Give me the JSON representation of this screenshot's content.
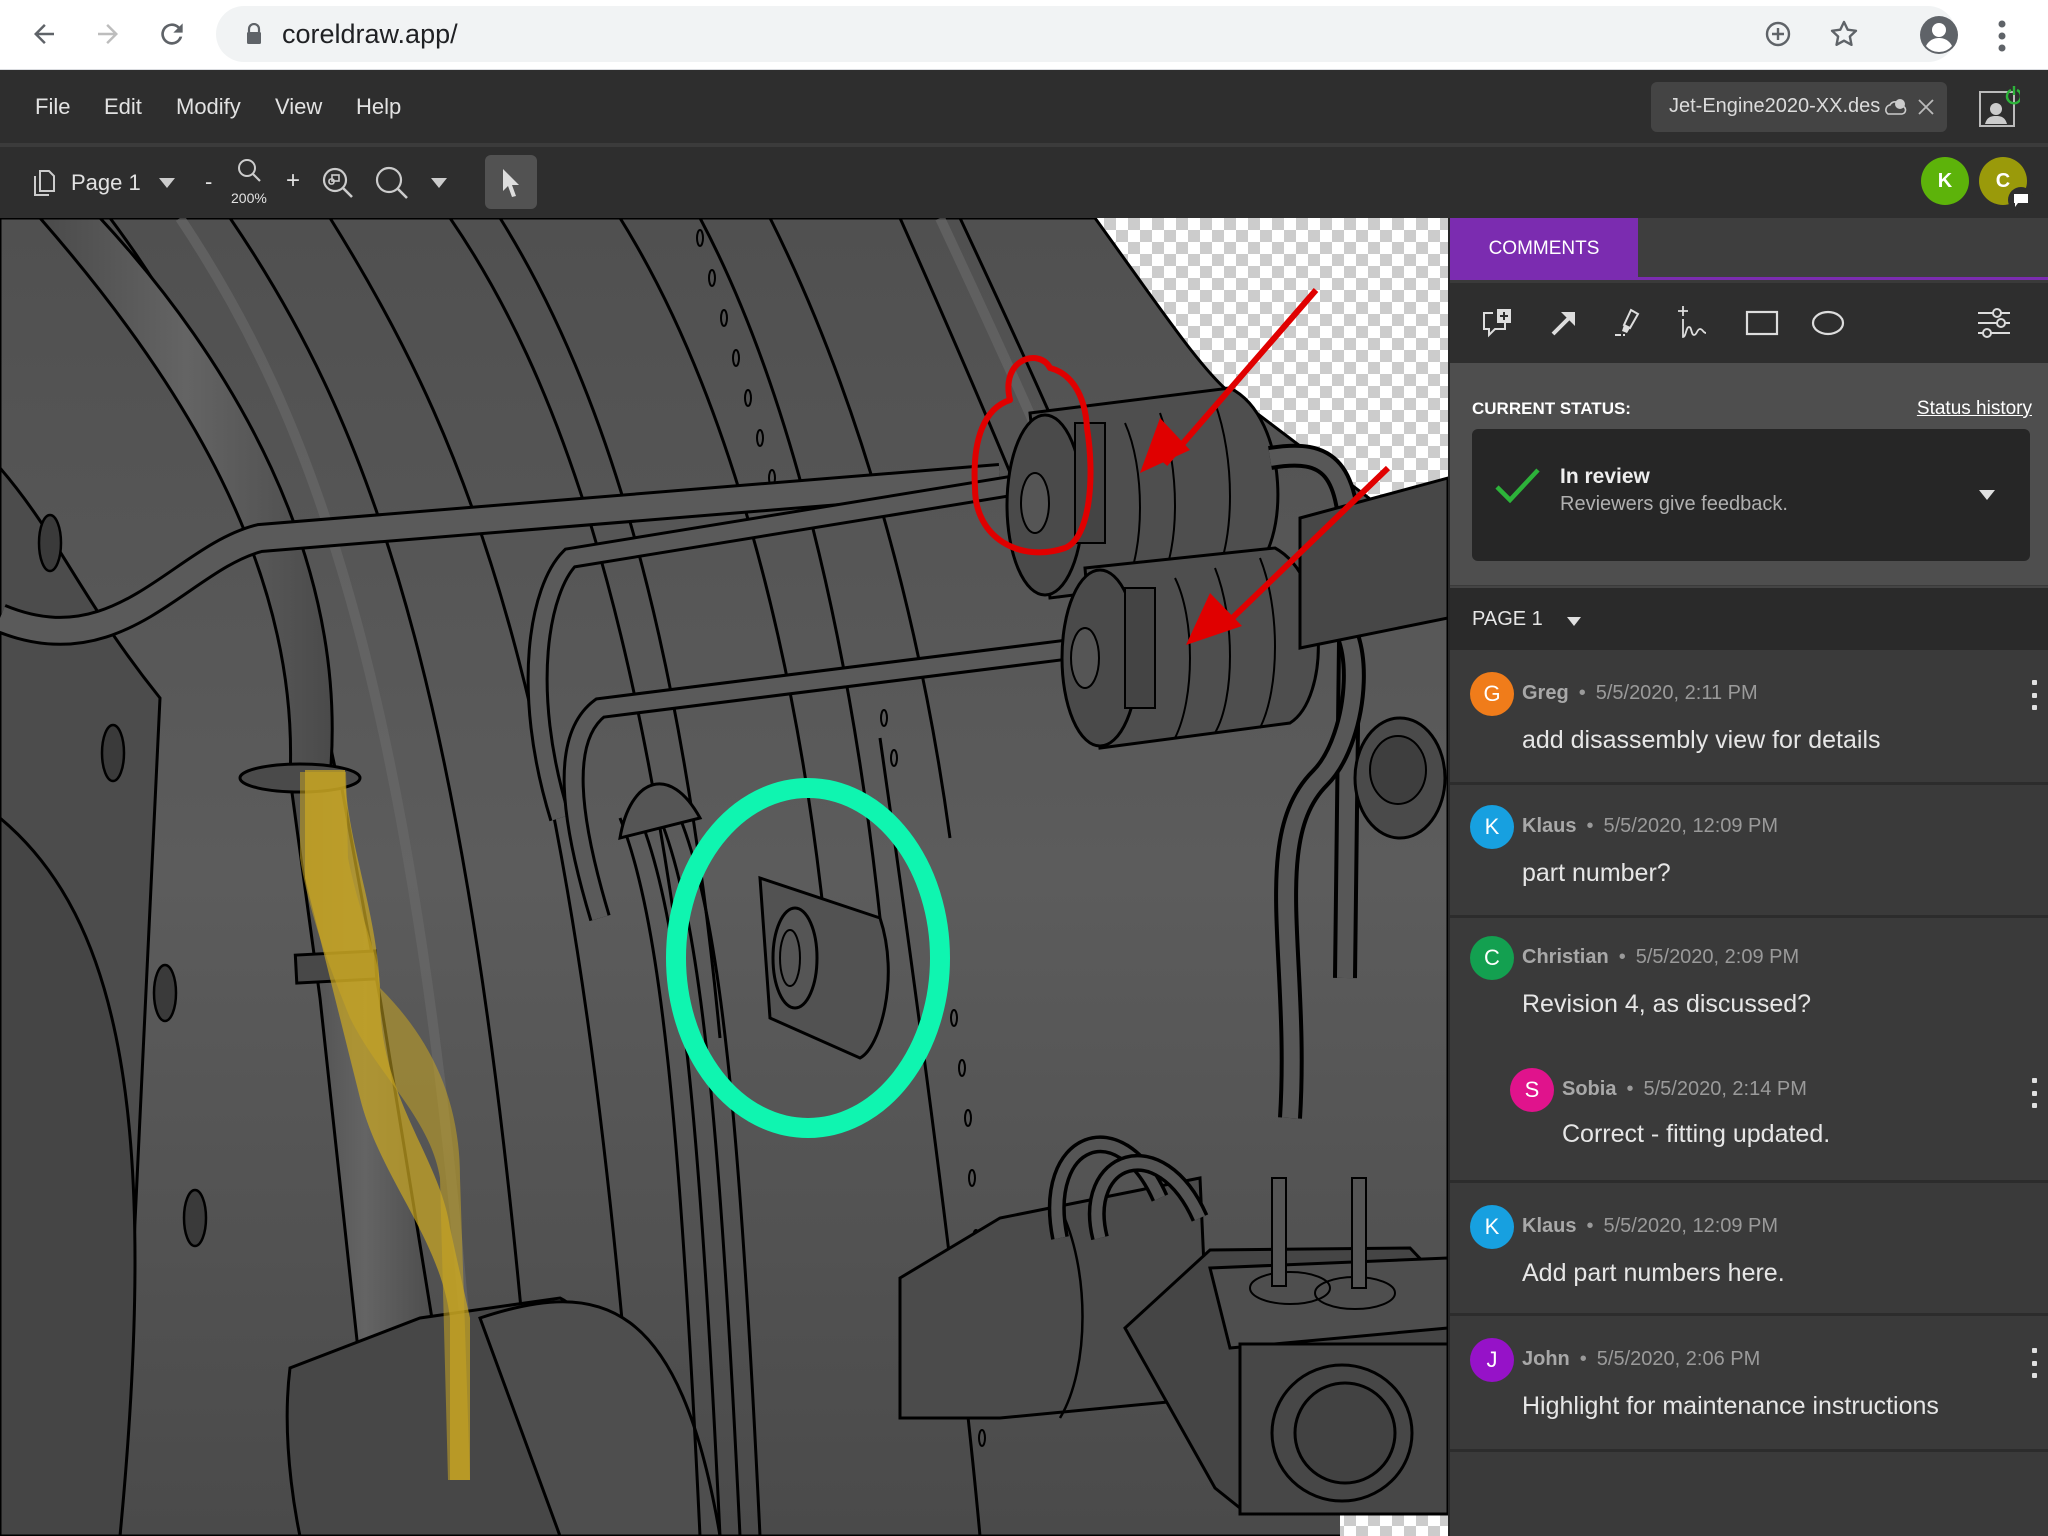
{
  "browser": {
    "url": "coreldraw.app/",
    "icons": [
      "back-arrow-icon",
      "forward-arrow-icon",
      "reload-icon",
      "lock-icon",
      "add-install-icon",
      "bookmark-star-icon",
      "profile-icon",
      "more-vertical-icon"
    ]
  },
  "menubar": {
    "items": [
      "File",
      "Edit",
      "Modify",
      "View",
      "Help"
    ],
    "document_tab": "Jet-Engine2020-XX.des",
    "document_tab_icons": [
      "cloud-user-icon",
      "close-icon"
    ],
    "user_status_icon": "review-mode-power-icon"
  },
  "toolbar": {
    "page_selector": "Page 1",
    "zoom_minus": "-",
    "zoom_plus": "+",
    "zoom_level": "200%",
    "icons": [
      "pages-icon",
      "chevron-down-icon",
      "zoom-icon",
      "zoom-to-selection-icon",
      "zoom-tool-icon",
      "chevron-down-icon",
      "pointer-tool-icon"
    ],
    "collaborators": [
      {
        "initial": "K",
        "color": "#5db30a"
      },
      {
        "initial": "C",
        "color": "#9a9a0a",
        "badge": "comment-icon"
      }
    ]
  },
  "canvas": {
    "annotations": [
      {
        "type": "freehand",
        "color": "#e00000"
      },
      {
        "type": "arrow",
        "color": "#e00000"
      },
      {
        "type": "arrow",
        "color": "#e00000"
      },
      {
        "type": "ellipse",
        "color": "#0ff5b0"
      },
      {
        "type": "highlighter",
        "color": "#c9a623"
      }
    ]
  },
  "panel": {
    "tab": "COMMENTS",
    "accent": "#7b2cb0",
    "tools": [
      "add-comment-icon",
      "arrow-tool-icon",
      "highlighter-icon",
      "freehand-tool-icon",
      "rectangle-tool-icon",
      "ellipse-tool-icon",
      "filter-settings-icon"
    ],
    "status": {
      "label": "CURRENT STATUS:",
      "history_link": "Status history",
      "title": "In review",
      "subtitle": "Reviewers give feedback.",
      "check_color": "#2db33a"
    },
    "page_filter": "PAGE 1",
    "comments": [
      {
        "initial": "G",
        "color": "#f07c1a",
        "author": "Greg",
        "time": "5/5/2020, 2:11 PM",
        "text": "add disassembly view for details",
        "menu": true
      },
      {
        "initial": "K",
        "color": "#17a0e0",
        "author": "Klaus",
        "time": "5/5/2020, 12:09 PM",
        "text": "part number?",
        "menu": false
      },
      {
        "initial": "C",
        "color": "#13a050",
        "author": "Christian",
        "time": "5/5/2020, 2:09 PM",
        "text": "Revision 4, as discussed?",
        "menu": false,
        "reply": {
          "initial": "S",
          "color": "#e0138c",
          "author": "Sobia",
          "time": "5/5/2020, 2:14 PM",
          "text": "Correct - fitting updated.",
          "menu": true
        }
      },
      {
        "initial": "K",
        "color": "#17a0e0",
        "author": "Klaus",
        "time": "5/5/2020, 12:09 PM",
        "text": "Add part numbers here.",
        "menu": false
      },
      {
        "initial": "J",
        "color": "#9612c8",
        "author": "John",
        "time": "5/5/2020, 2:06 PM",
        "text": "Highlight for maintenance instructions",
        "menu": true
      }
    ]
  }
}
